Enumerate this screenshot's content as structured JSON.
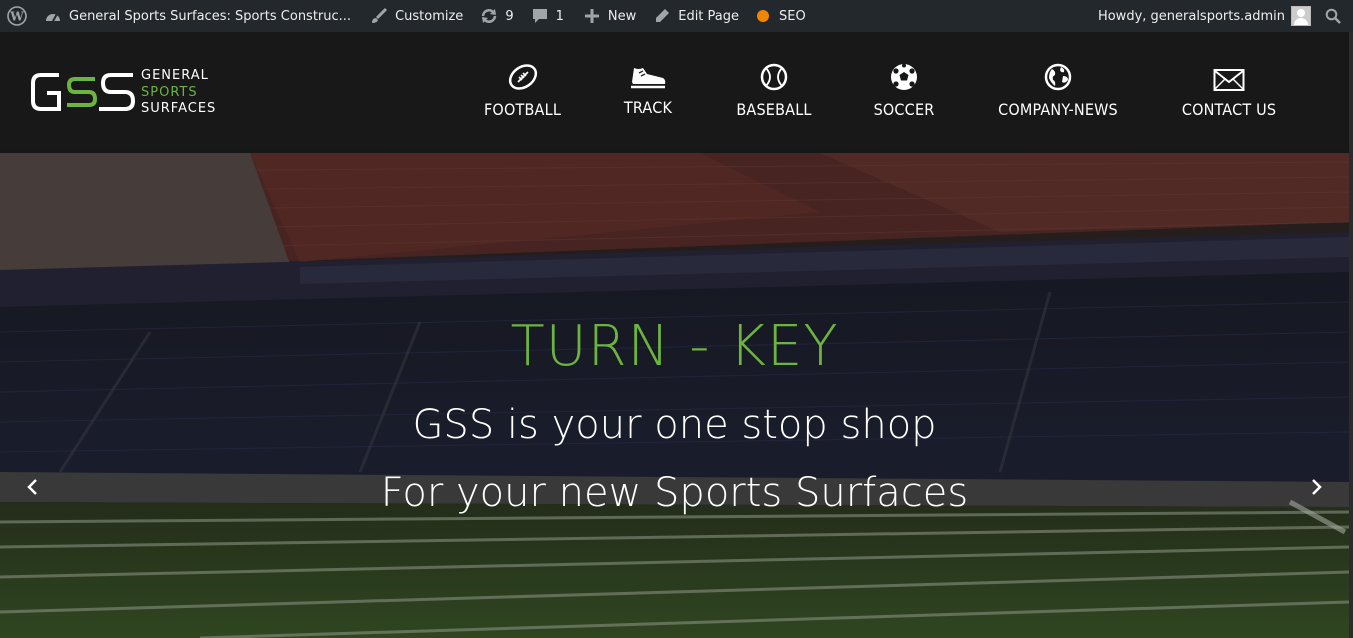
{
  "adminbar": {
    "site_title": "General Sports Surfaces: Sports Construc...",
    "customize": "Customize",
    "updates_count": "9",
    "comments_count": "1",
    "new_label": "New",
    "edit_page": "Edit Page",
    "seo": "SEO",
    "howdy": "Howdy, generalsports.admin"
  },
  "logo": {
    "line1": "GENERAL",
    "line2": "SPORTS",
    "line3": "SURFACES"
  },
  "nav": {
    "items": [
      {
        "label": "FOOTBALL",
        "icon": "football-icon"
      },
      {
        "label": "TRACK",
        "icon": "sneaker-icon"
      },
      {
        "label": "BASEBALL",
        "icon": "baseball-icon"
      },
      {
        "label": "SOCCER",
        "icon": "soccer-ball-icon"
      },
      {
        "label": "COMPANY-NEWS",
        "icon": "globe-icon"
      },
      {
        "label": "CONTACT US",
        "icon": "envelope-icon"
      }
    ]
  },
  "hero": {
    "heading": "TURN - KEY",
    "line1": "GSS is your one stop shop",
    "line2": "For your new Sports Surfaces"
  },
  "colors": {
    "brand_green": "#6cb33f",
    "adminbar_bg": "#23282d",
    "seo_dot": "#f18500"
  }
}
